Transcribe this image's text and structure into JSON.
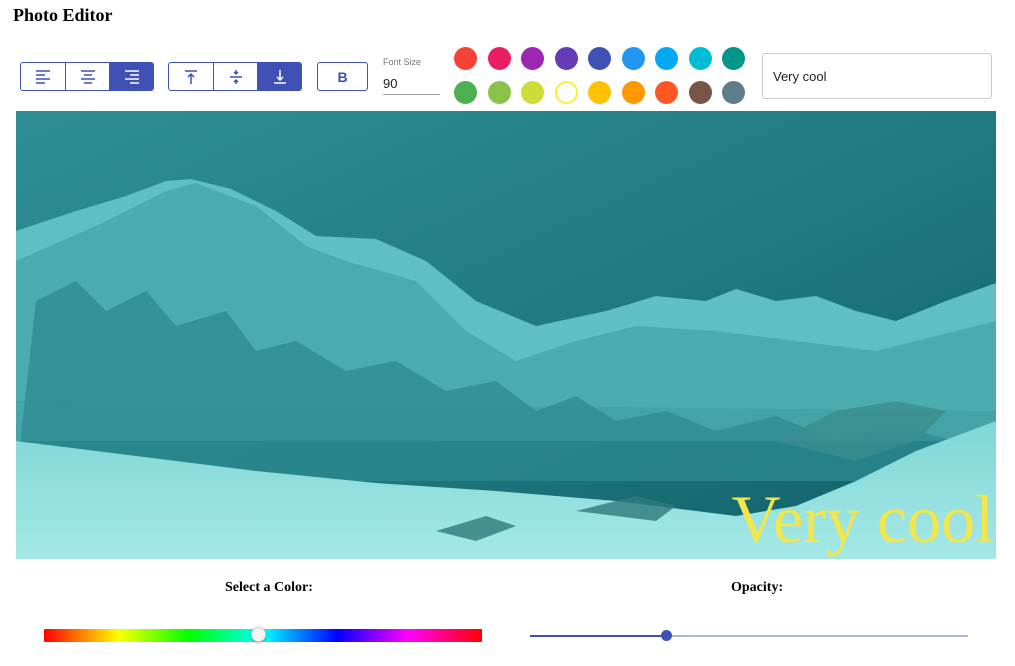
{
  "app": {
    "title": "Photo Editor"
  },
  "toolbar": {
    "align_horizontal": [
      {
        "name": "align-left",
        "icon": "align-left-icon",
        "active": false
      },
      {
        "name": "align-center",
        "icon": "align-center-icon",
        "active": false
      },
      {
        "name": "align-right",
        "icon": "align-right-icon",
        "active": true
      }
    ],
    "align_vertical": [
      {
        "name": "align-top",
        "icon": "align-top-icon",
        "active": false
      },
      {
        "name": "align-middle",
        "icon": "align-middle-icon",
        "active": false
      },
      {
        "name": "align-bottom",
        "icon": "align-bottom-icon",
        "active": true
      }
    ],
    "bold_label": "B",
    "font_size_label": "Font Size",
    "font_size_value": "90",
    "palette": [
      "#f44336",
      "#e91e63",
      "#9c27b0",
      "#673ab7",
      "#3f51b5",
      "#2196f3",
      "#03a9f4",
      "#00bcd4",
      "#009688",
      "#4caf50",
      "#8bc34a",
      "#cddc39",
      "#ffeb3b",
      "#ffc107",
      "#ff9800",
      "#ff5722",
      "#795548",
      "#607d8b"
    ],
    "selected_color": "#ffeb3b",
    "text_value": "Very cool"
  },
  "canvas": {
    "overlay_text": "Very cool",
    "text_color": "#f2e64a",
    "tint_color": "#1aa3a6"
  },
  "controls": {
    "color_label": "Select a Color:",
    "opacity_label": "Opacity:",
    "hue_position": 0.49,
    "opacity_value": 0.31
  },
  "accent_color": "#3f51b5"
}
